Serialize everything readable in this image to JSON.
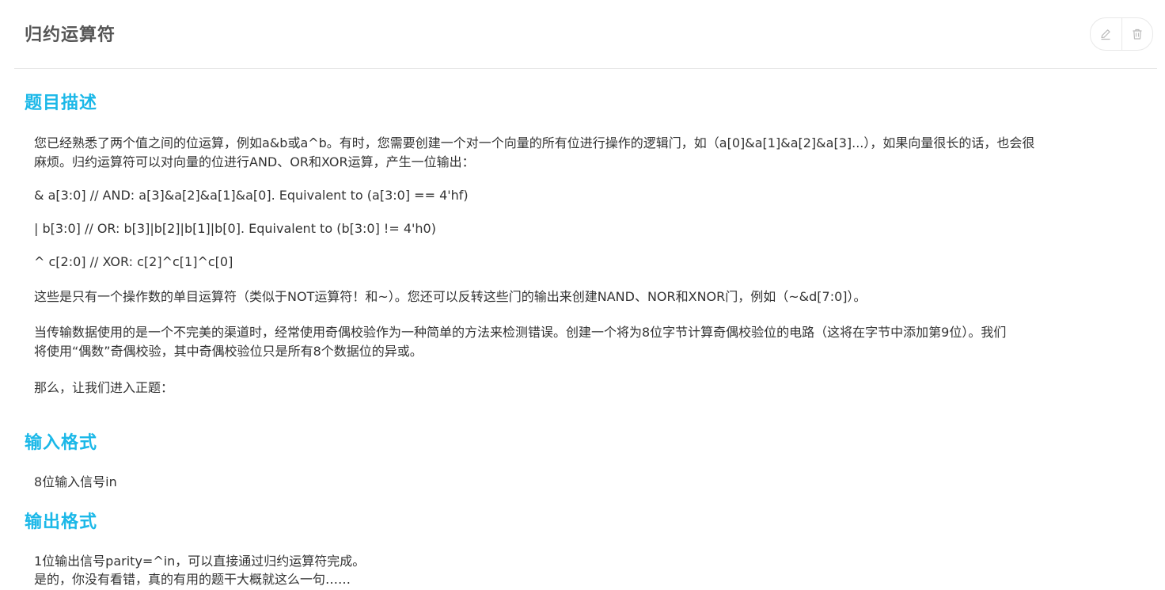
{
  "header": {
    "title": "归约运算符",
    "edit_icon": "pencil-icon",
    "delete_icon": "trash-icon"
  },
  "sections": {
    "description": {
      "title": "题目描述",
      "line1": "您已经熟悉了两个值之间的位运算，例如a&b或a^b。有时，您需要创建一个对一个向量的所有位进行操作的逻辑门，如（a[0]&a[1]&a[2]&a[3]...），如果向量很长的话，也会很",
      "line2": "麻烦。归约运算符可以对向量的位进行AND、OR和XOR运算，产生一位输出：",
      "code_and": "& a[3:0] // AND: a[3]&a[2]&a[1]&a[0]. Equivalent to (a[3:0] == 4'hf)",
      "code_or": "| b[3:0] // OR: b[3]|b[2]|b[1]|b[0]. Equivalent to (b[3:0] != 4'h0)",
      "code_xor": "^ c[2:0] // XOR: c[2]^c[1]^c[0]",
      "unary_note": "这些是只有一个操作数的单目运算符（类似于NOT运算符！和~）。您还可以反转这些门的输出来创建NAND、NOR和XNOR门，例如（~&d[7:0]）。",
      "parity_line1": "当传输数据使用的是一个不完美的渠道时，经常使用奇偶校验作为一种简单的方法来检测错误。创建一个将为8位字节计算奇偶校验位的电路（这将在字节中添加第9位）。我们",
      "parity_line2": "将使用“偶数”奇偶校验，其中奇偶校验位只是所有8个数据位的异或。",
      "closing": "那么，让我们进入正题："
    },
    "input": {
      "title": "输入格式",
      "text": "8位输入信号in"
    },
    "output": {
      "title": "输出格式",
      "line1": "1位输出信号parity=^in，可以直接通过归约运算符完成。",
      "line2": "是的，你没有看错，真的有用的题干大概就这么一句……"
    }
  },
  "colors": {
    "accent": "#1bb8e8",
    "title": "#555555",
    "text": "#333333",
    "border": "#e8e8e8",
    "icon": "#bbbbbb"
  }
}
